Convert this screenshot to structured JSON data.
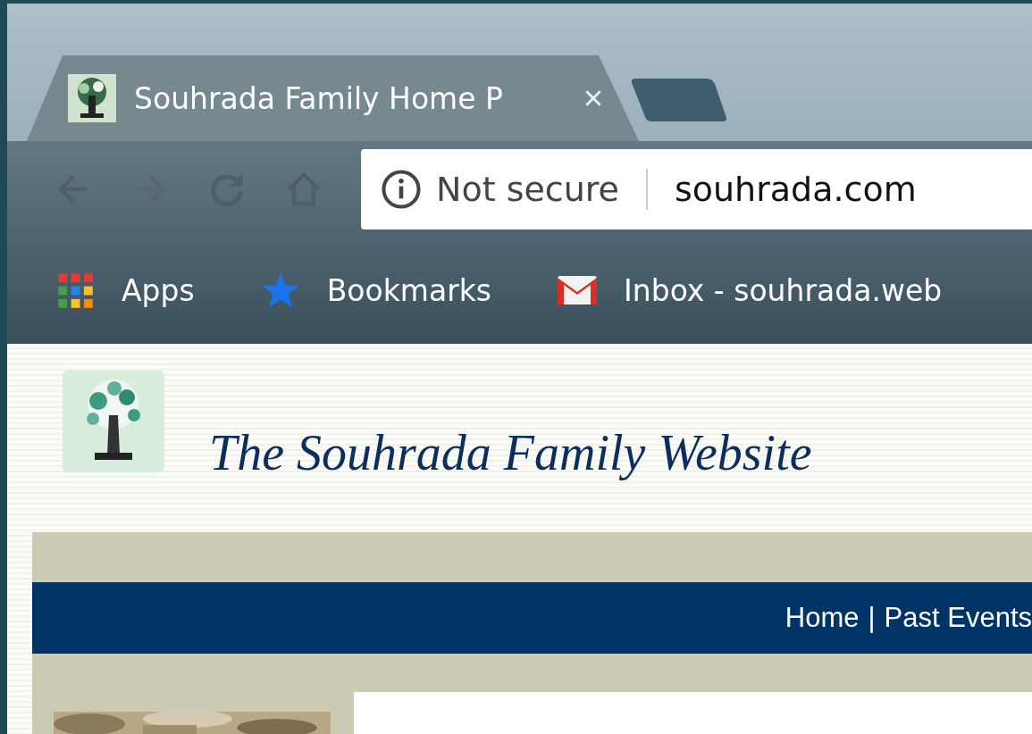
{
  "tabs": [
    {
      "title": "Souhrada Family Home P",
      "selected": true
    }
  ],
  "address_bar": {
    "security": "Not secure",
    "url": "souhrada.com"
  },
  "bookmarks": [
    {
      "label": "Apps",
      "kind": "apps"
    },
    {
      "label": "Bookmarks",
      "kind": "star"
    },
    {
      "label": "Inbox - souhrada.web",
      "kind": "mail"
    }
  ],
  "site": {
    "title": "The Souhrada Family Website",
    "nav": [
      "Home",
      "Past Events"
    ],
    "nav_separator": "|"
  }
}
